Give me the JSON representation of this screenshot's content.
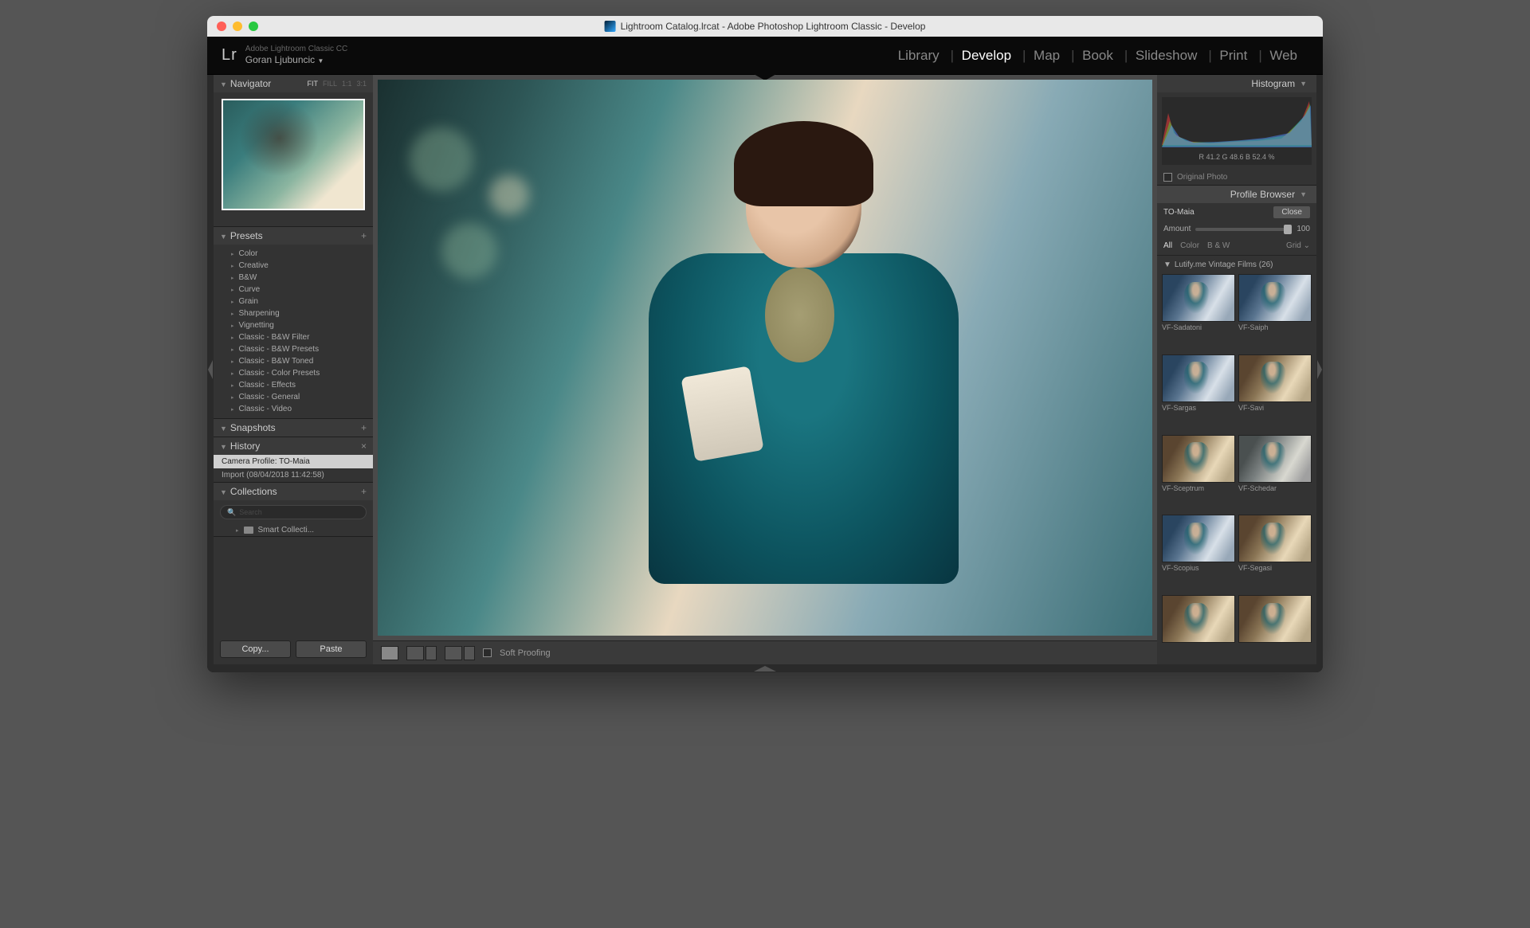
{
  "window": {
    "title": "Lightroom Catalog.lrcat - Adobe Photoshop Lightroom Classic - Develop"
  },
  "header": {
    "logo": "Lr",
    "product": "Adobe Lightroom Classic CC",
    "user": "Goran Ljubuncic",
    "modules": [
      "Library",
      "Develop",
      "Map",
      "Book",
      "Slideshow",
      "Print",
      "Web"
    ],
    "active_module": "Develop"
  },
  "navigator": {
    "title": "Navigator",
    "zoom": [
      "FIT",
      "FILL",
      "1:1",
      "3:1"
    ],
    "zoom_selected": "FIT"
  },
  "presets": {
    "title": "Presets",
    "items": [
      "Color",
      "Creative",
      "B&W",
      "Curve",
      "Grain",
      "Sharpening",
      "Vignetting",
      "Classic - B&W Filter",
      "Classic - B&W Presets",
      "Classic - B&W Toned",
      "Classic - Color Presets",
      "Classic - Effects",
      "Classic - General",
      "Classic - Video"
    ]
  },
  "snapshots": {
    "title": "Snapshots"
  },
  "history": {
    "title": "History",
    "items": [
      "Camera Profile: TO-Maia",
      "Import (08/04/2018 11:42:58)"
    ],
    "active": 0
  },
  "collections": {
    "title": "Collections",
    "search_placeholder": "Search",
    "items": [
      "Smart Collecti..."
    ]
  },
  "left_buttons": {
    "copy": "Copy...",
    "paste": "Paste"
  },
  "toolbar": {
    "soft_proofing": "Soft Proofing"
  },
  "histogram": {
    "title": "Histogram",
    "rgb": "R   41.2   G   48.6   B   52.4  %",
    "original": "Original Photo"
  },
  "profile_browser": {
    "title": "Profile Browser",
    "current": "TO-Maia",
    "close": "Close",
    "amount_label": "Amount",
    "amount_value": "100",
    "filters": [
      "All",
      "Color",
      "B & W"
    ],
    "filter_active": "All",
    "view": "Grid",
    "group": "Lutify.me Vintage Films (26)",
    "profiles": [
      {
        "name": "VF-Sadatoni",
        "tone": "cool"
      },
      {
        "name": "VF-Saiph",
        "tone": "cool"
      },
      {
        "name": "VF-Sargas",
        "tone": "cool"
      },
      {
        "name": "VF-Savi",
        "tone": "warm"
      },
      {
        "name": "VF-Sceptrum",
        "tone": "warm"
      },
      {
        "name": "VF-Schedar",
        "tone": "desat"
      },
      {
        "name": "VF-Scopius",
        "tone": "cool"
      },
      {
        "name": "VF-Segasi",
        "tone": "warm"
      },
      {
        "name": "",
        "tone": "warm"
      },
      {
        "name": "",
        "tone": "warm"
      }
    ]
  }
}
